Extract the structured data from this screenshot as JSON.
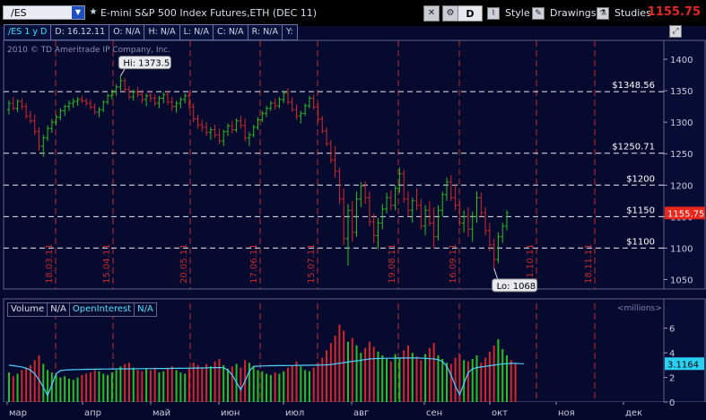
{
  "toolbar": {
    "symbol": "/ES",
    "chart_title": "E-mini S&P 500 Index Futures,ETH (DEC 11)",
    "aggregation_label": "D",
    "style_label": "Style",
    "drawings_label": "Drawings",
    "studies_label": "Studies",
    "last_price": "1155.75"
  },
  "info_bar": {
    "symbol_period": "/ES 1 y D",
    "date": "D: 16.12.11",
    "open": "O: N/A",
    "high": "H: N/A",
    "low": "L: N/A",
    "close": "C: N/A",
    "range": "R: N/A",
    "y": "Y:"
  },
  "copyright": "2010 © TD Ameritrade IP Company, Inc.",
  "price_panel": {
    "y_ticks": [
      "1400",
      "1350",
      "1300",
      "1250",
      "1200",
      "1150",
      "1100",
      "1050"
    ],
    "levels": [
      {
        "label": "$1348.56",
        "value": 1348.56
      },
      {
        "label": "$1250.71",
        "value": 1250.71
      },
      {
        "label": "$1200",
        "value": 1200
      },
      {
        "label": "$1150",
        "value": 1150
      },
      {
        "label": "$1100",
        "value": 1100
      }
    ],
    "last_label": "1155.75",
    "hi_label": "Hi: 1373.5",
    "lo_label": "Lo: 1068",
    "date_markers": [
      "18.03.11",
      "15.04.11",
      "20.05.11",
      "17.06.11",
      "15.07.11",
      "19.08.11",
      "16.09.11",
      "21.10.11",
      "18.11.11"
    ]
  },
  "volume_panel": {
    "volume_label": "Volume",
    "volume_value": "N/A",
    "oi_label": "OpenInterest",
    "oi_value": "N/A",
    "units": "<millions>",
    "y_ticks": [
      "6",
      "4",
      "2",
      "0"
    ],
    "oi_last": "3.1164"
  },
  "x_axis": {
    "months": [
      "мар",
      "апр",
      "май",
      "июн",
      "июл",
      "авг",
      "сен",
      "окт",
      "ноя",
      "дек"
    ]
  },
  "colors": {
    "background": "#050a2e",
    "up": "#26c21e",
    "down": "#d8262a",
    "oi_line": "#4fd0ff",
    "grid_red": "#c4292e",
    "last_price": "#e8261b"
  },
  "icons": [
    "crosshair-icon",
    "settings-icon",
    "style-icon",
    "drawings-icon",
    "studies-icon",
    "expand-icon",
    "star-icon",
    "dropdown-icon"
  ],
  "chart_data": {
    "type": "candlestick",
    "price_range": [
      1035,
      1430
    ],
    "volume_range": [
      0,
      7
    ],
    "note_series": "daily OHLC approx",
    "bars": [
      {
        "o": 1320,
        "h": 1335,
        "l": 1312,
        "c": 1330
      },
      {
        "o": 1330,
        "h": 1340,
        "l": 1318,
        "c": 1322
      },
      {
        "o": 1322,
        "h": 1336,
        "l": 1316,
        "c": 1333
      },
      {
        "o": 1333,
        "h": 1338,
        "l": 1320,
        "c": 1325
      },
      {
        "o": 1325,
        "h": 1330,
        "l": 1305,
        "c": 1310
      },
      {
        "o": 1310,
        "h": 1318,
        "l": 1298,
        "c": 1302
      },
      {
        "o": 1302,
        "h": 1312,
        "l": 1280,
        "c": 1285
      },
      {
        "o": 1285,
        "h": 1292,
        "l": 1255,
        "c": 1262
      },
      {
        "o": 1262,
        "h": 1280,
        "l": 1245,
        "c": 1275
      },
      {
        "o": 1275,
        "h": 1295,
        "l": 1270,
        "c": 1290
      },
      {
        "o": 1290,
        "h": 1305,
        "l": 1283,
        "c": 1300
      },
      {
        "o": 1300,
        "h": 1312,
        "l": 1295,
        "c": 1308
      },
      {
        "o": 1308,
        "h": 1322,
        "l": 1303,
        "c": 1318
      },
      {
        "o": 1318,
        "h": 1328,
        "l": 1310,
        "c": 1325
      },
      {
        "o": 1325,
        "h": 1335,
        "l": 1318,
        "c": 1330
      },
      {
        "o": 1330,
        "h": 1338,
        "l": 1323,
        "c": 1333
      },
      {
        "o": 1333,
        "h": 1340,
        "l": 1326,
        "c": 1336
      },
      {
        "o": 1336,
        "h": 1342,
        "l": 1330,
        "c": 1334
      },
      {
        "o": 1334,
        "h": 1338,
        "l": 1326,
        "c": 1330
      },
      {
        "o": 1330,
        "h": 1336,
        "l": 1320,
        "c": 1324
      },
      {
        "o": 1324,
        "h": 1330,
        "l": 1312,
        "c": 1316
      },
      {
        "o": 1316,
        "h": 1324,
        "l": 1308,
        "c": 1320
      },
      {
        "o": 1320,
        "h": 1335,
        "l": 1316,
        "c": 1332
      },
      {
        "o": 1332,
        "h": 1345,
        "l": 1328,
        "c": 1342
      },
      {
        "o": 1342,
        "h": 1352,
        "l": 1336,
        "c": 1348
      },
      {
        "o": 1348,
        "h": 1360,
        "l": 1342,
        "c": 1356
      },
      {
        "o": 1356,
        "h": 1373.5,
        "l": 1350,
        "c": 1366
      },
      {
        "o": 1366,
        "h": 1370,
        "l": 1348,
        "c": 1352
      },
      {
        "o": 1352,
        "h": 1358,
        "l": 1336,
        "c": 1340
      },
      {
        "o": 1340,
        "h": 1352,
        "l": 1334,
        "c": 1348
      },
      {
        "o": 1348,
        "h": 1356,
        "l": 1340,
        "c": 1344
      },
      {
        "o": 1344,
        "h": 1352,
        "l": 1330,
        "c": 1336
      },
      {
        "o": 1336,
        "h": 1345,
        "l": 1325,
        "c": 1342
      },
      {
        "o": 1342,
        "h": 1350,
        "l": 1332,
        "c": 1338
      },
      {
        "o": 1338,
        "h": 1344,
        "l": 1326,
        "c": 1330
      },
      {
        "o": 1330,
        "h": 1342,
        "l": 1322,
        "c": 1338
      },
      {
        "o": 1338,
        "h": 1348,
        "l": 1330,
        "c": 1344
      },
      {
        "o": 1344,
        "h": 1350,
        "l": 1328,
        "c": 1332
      },
      {
        "o": 1332,
        "h": 1340,
        "l": 1318,
        "c": 1325
      },
      {
        "o": 1325,
        "h": 1334,
        "l": 1315,
        "c": 1330
      },
      {
        "o": 1330,
        "h": 1340,
        "l": 1322,
        "c": 1336
      },
      {
        "o": 1336,
        "h": 1346,
        "l": 1330,
        "c": 1342
      },
      {
        "o": 1342,
        "h": 1348,
        "l": 1320,
        "c": 1324
      },
      {
        "o": 1324,
        "h": 1330,
        "l": 1300,
        "c": 1305
      },
      {
        "o": 1305,
        "h": 1312,
        "l": 1290,
        "c": 1296
      },
      {
        "o": 1296,
        "h": 1304,
        "l": 1285,
        "c": 1292
      },
      {
        "o": 1292,
        "h": 1300,
        "l": 1278,
        "c": 1284
      },
      {
        "o": 1284,
        "h": 1292,
        "l": 1272,
        "c": 1288
      },
      {
        "o": 1288,
        "h": 1296,
        "l": 1275,
        "c": 1280
      },
      {
        "o": 1280,
        "h": 1290,
        "l": 1265,
        "c": 1270
      },
      {
        "o": 1270,
        "h": 1288,
        "l": 1262,
        "c": 1285
      },
      {
        "o": 1285,
        "h": 1298,
        "l": 1278,
        "c": 1294
      },
      {
        "o": 1294,
        "h": 1302,
        "l": 1282,
        "c": 1288
      },
      {
        "o": 1288,
        "h": 1306,
        "l": 1284,
        "c": 1302
      },
      {
        "o": 1302,
        "h": 1310,
        "l": 1290,
        "c": 1295
      },
      {
        "o": 1295,
        "h": 1306,
        "l": 1270,
        "c": 1275
      },
      {
        "o": 1275,
        "h": 1285,
        "l": 1262,
        "c": 1280
      },
      {
        "o": 1280,
        "h": 1296,
        "l": 1276,
        "c": 1292
      },
      {
        "o": 1292,
        "h": 1308,
        "l": 1288,
        "c": 1304
      },
      {
        "o": 1304,
        "h": 1318,
        "l": 1300,
        "c": 1314
      },
      {
        "o": 1314,
        "h": 1326,
        "l": 1308,
        "c": 1322
      },
      {
        "o": 1322,
        "h": 1334,
        "l": 1318,
        "c": 1330
      },
      {
        "o": 1330,
        "h": 1338,
        "l": 1320,
        "c": 1326
      },
      {
        "o": 1326,
        "h": 1340,
        "l": 1322,
        "c": 1336
      },
      {
        "o": 1336,
        "h": 1350,
        "l": 1330,
        "c": 1346
      },
      {
        "o": 1346,
        "h": 1354,
        "l": 1328,
        "c": 1332
      },
      {
        "o": 1332,
        "h": 1340,
        "l": 1316,
        "c": 1320
      },
      {
        "o": 1320,
        "h": 1328,
        "l": 1304,
        "c": 1310
      },
      {
        "o": 1310,
        "h": 1318,
        "l": 1298,
        "c": 1314
      },
      {
        "o": 1314,
        "h": 1330,
        "l": 1310,
        "c": 1326
      },
      {
        "o": 1326,
        "h": 1342,
        "l": 1322,
        "c": 1338
      },
      {
        "o": 1338,
        "h": 1344,
        "l": 1320,
        "c": 1324
      },
      {
        "o": 1324,
        "h": 1330,
        "l": 1300,
        "c": 1305
      },
      {
        "o": 1305,
        "h": 1310,
        "l": 1282,
        "c": 1286
      },
      {
        "o": 1286,
        "h": 1292,
        "l": 1262,
        "c": 1266
      },
      {
        "o": 1266,
        "h": 1272,
        "l": 1235,
        "c": 1240
      },
      {
        "o": 1240,
        "h": 1262,
        "l": 1212,
        "c": 1222
      },
      {
        "o": 1222,
        "h": 1228,
        "l": 1170,
        "c": 1178
      },
      {
        "o": 1178,
        "h": 1195,
        "l": 1105,
        "c": 1115
      },
      {
        "o": 1115,
        "h": 1170,
        "l": 1072,
        "c": 1160
      },
      {
        "o": 1160,
        "h": 1175,
        "l": 1110,
        "c": 1125
      },
      {
        "o": 1125,
        "h": 1190,
        "l": 1118,
        "c": 1178
      },
      {
        "o": 1178,
        "h": 1205,
        "l": 1165,
        "c": 1198
      },
      {
        "o": 1198,
        "h": 1206,
        "l": 1170,
        "c": 1180
      },
      {
        "o": 1180,
        "h": 1190,
        "l": 1135,
        "c": 1142
      },
      {
        "o": 1142,
        "h": 1155,
        "l": 1108,
        "c": 1120
      },
      {
        "o": 1120,
        "h": 1148,
        "l": 1098,
        "c": 1140
      },
      {
        "o": 1140,
        "h": 1170,
        "l": 1130,
        "c": 1162
      },
      {
        "o": 1162,
        "h": 1188,
        "l": 1155,
        "c": 1180
      },
      {
        "o": 1180,
        "h": 1192,
        "l": 1160,
        "c": 1168
      },
      {
        "o": 1168,
        "h": 1200,
        "l": 1160,
        "c": 1195
      },
      {
        "o": 1195,
        "h": 1228,
        "l": 1188,
        "c": 1218
      },
      {
        "o": 1218,
        "h": 1225,
        "l": 1172,
        "c": 1178
      },
      {
        "o": 1178,
        "h": 1190,
        "l": 1150,
        "c": 1160
      },
      {
        "o": 1160,
        "h": 1180,
        "l": 1140,
        "c": 1175
      },
      {
        "o": 1175,
        "h": 1195,
        "l": 1160,
        "c": 1168
      },
      {
        "o": 1168,
        "h": 1178,
        "l": 1130,
        "c": 1135
      },
      {
        "o": 1135,
        "h": 1168,
        "l": 1120,
        "c": 1160
      },
      {
        "o": 1160,
        "h": 1175,
        "l": 1135,
        "c": 1140
      },
      {
        "o": 1140,
        "h": 1165,
        "l": 1100,
        "c": 1118
      },
      {
        "o": 1118,
        "h": 1168,
        "l": 1112,
        "c": 1160
      },
      {
        "o": 1160,
        "h": 1190,
        "l": 1150,
        "c": 1185
      },
      {
        "o": 1185,
        "h": 1212,
        "l": 1175,
        "c": 1205
      },
      {
        "o": 1205,
        "h": 1216,
        "l": 1175,
        "c": 1180
      },
      {
        "o": 1180,
        "h": 1200,
        "l": 1160,
        "c": 1168
      },
      {
        "o": 1168,
        "h": 1175,
        "l": 1135,
        "c": 1140
      },
      {
        "o": 1140,
        "h": 1160,
        "l": 1125,
        "c": 1150
      },
      {
        "o": 1150,
        "h": 1165,
        "l": 1118,
        "c": 1130
      },
      {
        "o": 1130,
        "h": 1158,
        "l": 1110,
        "c": 1150
      },
      {
        "o": 1150,
        "h": 1190,
        "l": 1140,
        "c": 1180
      },
      {
        "o": 1180,
        "h": 1188,
        "l": 1150,
        "c": 1156
      },
      {
        "o": 1156,
        "h": 1165,
        "l": 1120,
        "c": 1128
      },
      {
        "o": 1128,
        "h": 1140,
        "l": 1095,
        "c": 1105
      },
      {
        "o": 1105,
        "h": 1115,
        "l": 1068,
        "c": 1082
      },
      {
        "o": 1082,
        "h": 1125,
        "l": 1076,
        "c": 1118
      },
      {
        "o": 1118,
        "h": 1140,
        "l": 1108,
        "c": 1135
      },
      {
        "o": 1135,
        "h": 1160,
        "l": 1128,
        "c": 1155.75
      }
    ],
    "volume": [
      2.4,
      2.1,
      2.3,
      2.6,
      2.8,
      3.0,
      3.4,
      3.8,
      3.1,
      2.6,
      2.4,
      2.2,
      2.0,
      2.1,
      1.9,
      1.8,
      2.0,
      2.2,
      2.3,
      2.4,
      2.6,
      2.5,
      2.3,
      2.2,
      2.4,
      2.6,
      2.9,
      3.1,
      3.2,
      2.8,
      2.6,
      2.5,
      2.7,
      2.6,
      2.8,
      2.4,
      2.5,
      2.7,
      2.9,
      2.6,
      2.4,
      2.3,
      2.8,
      3.2,
      3.0,
      2.8,
      3.1,
      2.9,
      3.3,
      3.5,
      3.0,
      2.7,
      2.9,
      3.1,
      2.8,
      3.4,
      3.2,
      2.9,
      2.6,
      2.5,
      2.3,
      2.2,
      2.4,
      2.3,
      2.5,
      2.8,
      3.0,
      3.3,
      2.9,
      2.6,
      2.5,
      2.8,
      3.2,
      3.6,
      4.2,
      4.8,
      5.4,
      6.3,
      5.8,
      4.9,
      5.2,
      4.6,
      4.0,
      4.4,
      4.9,
      4.5,
      4.1,
      3.8,
      3.5,
      3.3,
      3.9,
      3.6,
      4.2,
      4.6,
      4.0,
      3.7,
      3.4,
      3.9,
      4.4,
      4.8,
      3.8,
      3.5,
      3.2,
      3.1,
      3.6,
      3.9,
      3.4,
      3.3,
      3.5,
      3.8,
      3.2,
      3.6,
      4.1,
      4.6,
      5.1,
      4.3,
      3.8,
      3.4,
      3.1
    ],
    "open_interest": [
      3.0,
      2.95,
      2.9,
      2.85,
      2.75,
      2.6,
      2.3,
      1.8,
      1.2,
      0.55,
      1.4,
      2.3,
      2.55,
      2.6,
      2.62,
      2.63,
      2.64,
      2.65,
      2.66,
      2.66,
      2.67,
      2.67,
      2.68,
      2.68,
      2.69,
      2.69,
      2.7,
      2.7,
      2.7,
      2.7,
      2.71,
      2.71,
      2.72,
      2.72,
      2.72,
      2.73,
      2.73,
      2.73,
      2.74,
      2.74,
      2.74,
      2.75,
      2.75,
      2.76,
      2.76,
      2.77,
      2.78,
      2.79,
      2.8,
      2.8,
      2.79,
      2.6,
      2.2,
      1.6,
      1.0,
      1.7,
      2.5,
      2.9,
      2.92,
      2.93,
      2.94,
      2.95,
      2.95,
      2.96,
      2.96,
      2.97,
      2.97,
      2.98,
      2.98,
      2.99,
      2.99,
      3.0,
      3.0,
      3.01,
      3.02,
      3.05,
      3.1,
      3.15,
      3.2,
      3.25,
      3.3,
      3.35,
      3.4,
      3.45,
      3.5,
      3.52,
      3.54,
      3.55,
      3.56,
      3.56,
      3.57,
      3.57,
      3.58,
      3.58,
      3.58,
      3.58,
      3.57,
      3.55,
      3.52,
      3.5,
      3.45,
      3.3,
      2.9,
      2.2,
      1.3,
      0.6,
      1.5,
      2.4,
      2.7,
      2.8,
      2.85,
      2.9,
      2.95,
      3.0,
      3.05,
      3.1,
      3.12,
      3.14,
      3.15,
      3.12,
      3.1164
    ]
  }
}
